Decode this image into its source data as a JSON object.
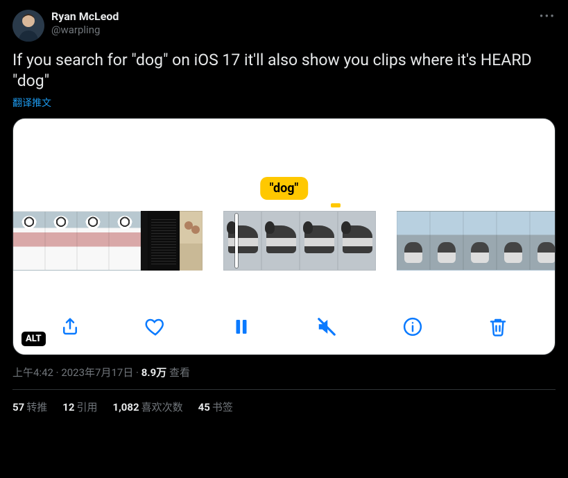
{
  "user": {
    "display_name": "Ryan McLeod",
    "handle": "@warpling"
  },
  "tweet_text": "If you search for \"dog\" on iOS 17 it'll also show you clips where it's HEARD \"dog\"",
  "translate_label": "翻译推文",
  "media": {
    "dog_label": "\"dog\"",
    "alt_badge": "ALT"
  },
  "meta": {
    "time": "上午4:42",
    "dot1": " · ",
    "date": "2023年7月17日",
    "dot2": " · ",
    "views_number": "8.9万",
    "views_label": " 查看"
  },
  "stats": {
    "retweets_n": "57",
    "retweets_l": "转推",
    "quotes_n": "12",
    "quotes_l": "引用",
    "likes_n": "1,082",
    "likes_l": "喜欢次数",
    "bookmarks_n": "45",
    "bookmarks_l": "书签"
  },
  "more": "•••"
}
